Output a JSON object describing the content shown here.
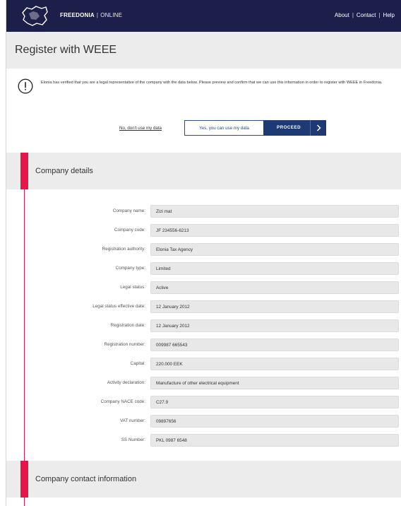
{
  "header": {
    "brand_name": "FREEDONIA",
    "brand_sep": "|",
    "brand_suffix": "ONLINE",
    "links": {
      "about": "About",
      "contact": "Contact",
      "help": "Help",
      "sep": "|"
    }
  },
  "page": {
    "title": "Register with WEEE"
  },
  "notice": {
    "icon": "exclamation-circle-icon",
    "text": "Elonia has verified that you are a legal representative of the company with the data below. Please preview and confirm that we can use this information in order to register with WEEE in Freedonia."
  },
  "consent": {
    "decline_label": "No, don't use my data",
    "accept_label": "Yes, you can use my data",
    "proceed_label": "PROCEED"
  },
  "sections": {
    "company_details": {
      "title": "Company details"
    },
    "company_contact": {
      "title": "Company contact information"
    }
  },
  "company_fields": [
    {
      "label": "Company name:",
      "value": "Zizi mat"
    },
    {
      "label": "Company code:",
      "value": "JF 234556-6213"
    },
    {
      "label": "Registration authority:",
      "value": "Elonia Tax Agency"
    },
    {
      "label": "Company type:",
      "value": "Limited"
    },
    {
      "label": "Legal status:",
      "value": "Active"
    },
    {
      "label": "Legal status effective date:",
      "value": "12 January 2012"
    },
    {
      "label": "Registration date:",
      "value": "12 January 2012"
    },
    {
      "label": "Registration number:",
      "value": "009987 665543"
    },
    {
      "label": "Capital:",
      "value": "220.000 EEK"
    },
    {
      "label": "Activity declaration:",
      "value": "Manufacture of other electrical equipment"
    },
    {
      "label": "Company NACE code:",
      "value": "C27.9"
    },
    {
      "label": "VAT number:",
      "value": "09897656"
    },
    {
      "label": "SS Number:",
      "value": "PKL 0987 6548"
    }
  ],
  "colors": {
    "header_bg": "#1d1f4b",
    "accent": "#e6164b",
    "primary_button": "#1e3a74",
    "section_bg": "#ececec"
  }
}
